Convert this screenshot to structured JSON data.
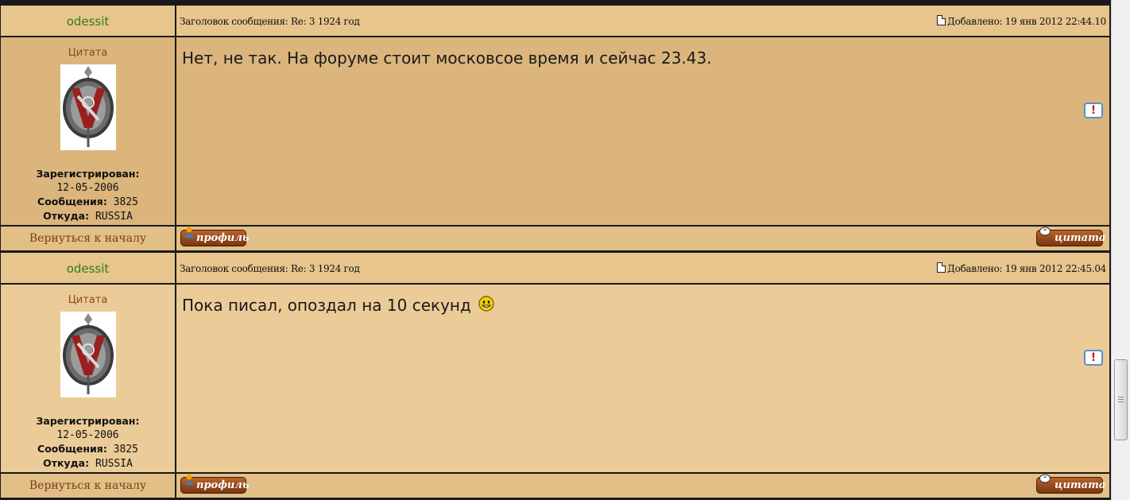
{
  "posts": [
    {
      "author": "odessit",
      "subject": "Заголовок сообщения: Re: 3 1924 год",
      "posted": "Добавлено: 19 янв 2012 22:44.10",
      "rank": "Цитата",
      "registered_label": "Зарегистрирован:",
      "registered": "12-05-2006",
      "posts_label": "Сообщения:",
      "posts_count": "3825",
      "location_label": "Откуда:",
      "location": "RUSSIA",
      "message": "Нет, не так. На форуме стоит московсое время и сейчас 23.43.",
      "report_glyph": "!",
      "back_link": "Вернуться к началу",
      "profile_label": "профиль",
      "quote_label": "цитата"
    },
    {
      "author": "odessit",
      "subject": "Заголовок сообщения: Re: 3 1924 год",
      "posted": "Добавлено: 19 янв 2012 22:45.04",
      "rank": "Цитата",
      "registered_label": "Зарегистрирован:",
      "registered": "12-05-2006",
      "posts_label": "Сообщения:",
      "posts_count": "3825",
      "location_label": "Откуда:",
      "location": "RUSSIA",
      "message": "Пока писал, опоздал на 10 секунд",
      "message_icon": "smiley-icon",
      "report_glyph": "!",
      "back_link": "Вернуться к началу",
      "profile_label": "профиль",
      "quote_label": "цитата"
    }
  ],
  "colors": {
    "author": "#2e7d1b",
    "rank": "#8a4a1e",
    "post1_body_bg": "#dbb57c",
    "post2_body_bg": "#ebcb97",
    "header_bg": "#e7c58d",
    "button_bg": "#8a3e14"
  },
  "icons": {
    "posted": "document-icon",
    "report": "report-post-icon",
    "profile": "profile-icon",
    "quote": "quote-icon",
    "avatar": "nkvd-badge-avatar"
  }
}
